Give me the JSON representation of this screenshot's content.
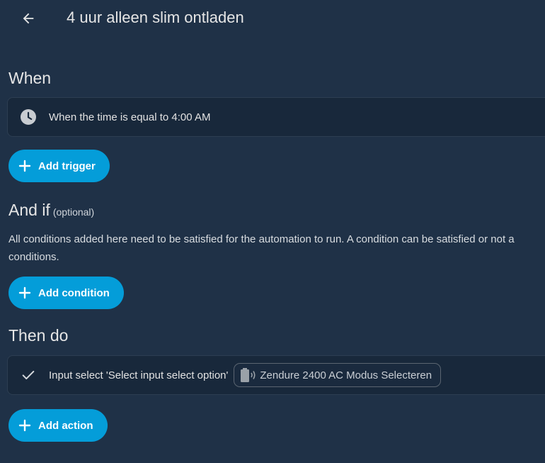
{
  "header": {
    "title": "4 uur alleen slim ontladen"
  },
  "when": {
    "title": "When",
    "trigger_text": "When the time is equal to 4:00 AM",
    "add_button": "Add trigger"
  },
  "and_if": {
    "title": "And if",
    "optional": "(optional)",
    "description": "All conditions added here need to be satisfied for the automation to run. A condition can be satisfied or not a",
    "description_line2": "conditions.",
    "add_button": "Add condition"
  },
  "then_do": {
    "title": "Then do",
    "action_text": "Input select 'Select input select option'",
    "entity_chip": "Zendure 2400 AC Modus Selecteren",
    "add_button": "Add action"
  },
  "colors": {
    "background": "#1f3147",
    "card": "#18283b",
    "accent": "#049dd9"
  },
  "icons": [
    "arrow-left-icon",
    "clock-icon",
    "plus-icon",
    "check-icon",
    "battery-wireless-icon"
  ]
}
